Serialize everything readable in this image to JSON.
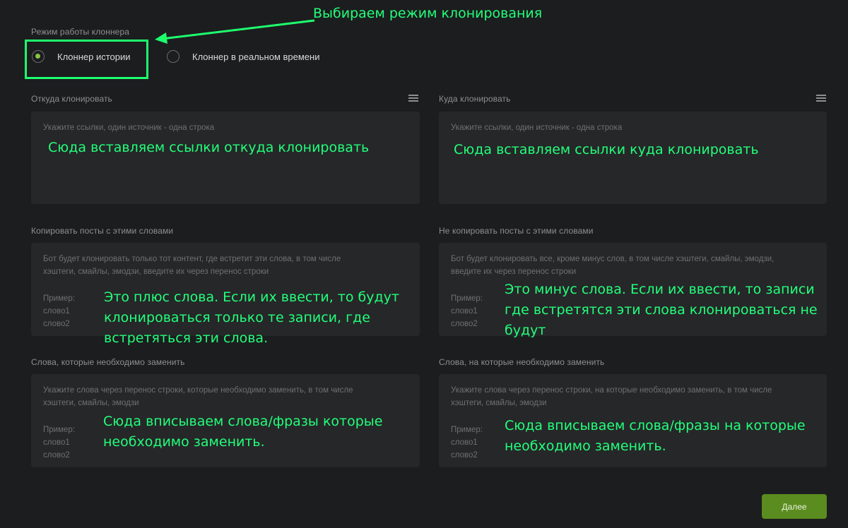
{
  "annotations": {
    "mode_hint": "Выбираем режим клонирования",
    "from_hint": "Сюда вставляем ссылки откуда клонировать",
    "to_hint": "Сюда вставляем ссылки куда клонировать",
    "plus_hint": "Это плюс слова. Если их ввести, то будут клонироваться только те записи, где встретяться эти слова.",
    "minus_hint": "Это минус слова. Если их ввести, то записи где встретятся эти слова клонироваться не будут",
    "replace_hint": "Сюда вписываем слова/фразы которые необходимо заменить.",
    "replace_with_hint": "Сюда вписываем слова/фразы на которые необходимо заменить."
  },
  "mode": {
    "label": "Режим работы клоннера",
    "options": [
      {
        "label": "Клоннер истории",
        "selected": true
      },
      {
        "label": "Клоннер в реальном времени",
        "selected": false
      }
    ]
  },
  "source": {
    "label": "Откуда клонировать",
    "placeholder": "Укажите ссылки, один источник - одна строка"
  },
  "target": {
    "label": "Куда клонировать",
    "placeholder": "Укажите ссылки, один источник - одна строка"
  },
  "include_words": {
    "label": "Копировать посты с этими словами",
    "placeholder_line1": "Бот будет клонировать только тот контент, где встретит эти слова, в том числе",
    "placeholder_line2": "хэштеги, смайлы, эмодзи, введите их через перенос строки",
    "example_title": "Пример:",
    "example_1": "слово1",
    "example_2": "слово2"
  },
  "exclude_words": {
    "label": "Не копировать посты с этими словами",
    "placeholder_line1": "Бот будет клонировать все, кроме минус слов, в том числе хэштеги, смайлы, эмодзи,",
    "placeholder_line2": "введите их через перенос строки",
    "example_title": "Пример:",
    "example_1": "слово1",
    "example_2": "слово2"
  },
  "replace_words": {
    "label": "Слова, которые необходимо заменить",
    "placeholder_line1": "Укажите слова через перенос строки, которые необходимо заменить, в том числе",
    "placeholder_line2": "хэштеги, смайлы, эмодзи",
    "example_title": "Пример:",
    "example_1": "слово1",
    "example_2": "слово2"
  },
  "replace_with_words": {
    "label": "Слова, на которые необходимо заменить",
    "placeholder_line1": "Укажите слова через перенос строки, на  которые необходимо заменить, в том числе",
    "placeholder_line2": "хэштеги, смайлы, эмодзи",
    "example_title": "Пример:",
    "example_1": "слово1",
    "example_2": "слово2"
  },
  "next_button": "Далее",
  "colors": {
    "background": "#1c1d1f",
    "field": "#262729",
    "accent": "#8bc34a",
    "button": "#5b8c1f",
    "annotation": "#22ff7a"
  }
}
